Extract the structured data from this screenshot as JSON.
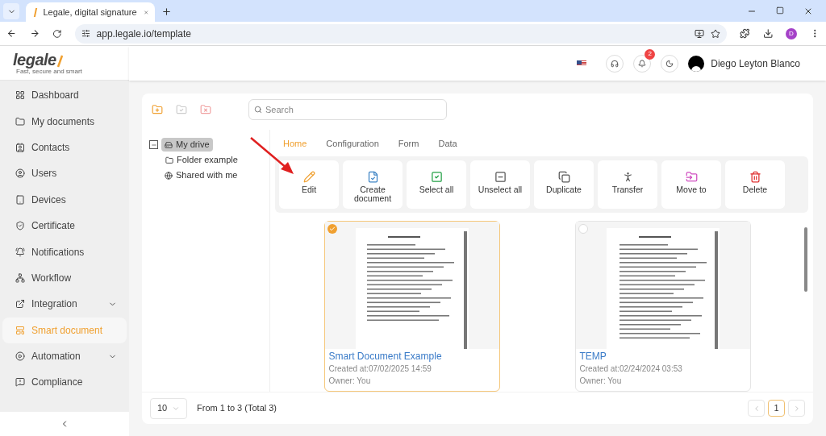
{
  "browser": {
    "tab_title": "Legale, digital signature",
    "url": "app.legale.io/template",
    "profile": "D"
  },
  "logo": {
    "text": "legale",
    "tagline": "Fast, secure and smart"
  },
  "header": {
    "notifications": "2",
    "user": "Diego Leyton Blanco"
  },
  "sidebar": {
    "items": [
      {
        "label": "Dashboard",
        "selected": false
      },
      {
        "label": "My documents",
        "selected": false
      },
      {
        "label": "Contacts",
        "selected": false
      },
      {
        "label": "Users",
        "selected": false
      },
      {
        "label": "Devices",
        "selected": false
      },
      {
        "label": "Certificate",
        "selected": false
      },
      {
        "label": "Notifications",
        "selected": false
      },
      {
        "label": "Workflow",
        "selected": false
      },
      {
        "label": "Integration",
        "selected": false,
        "expandable": true
      },
      {
        "label": "Smart document",
        "selected": true
      },
      {
        "label": "Automation",
        "selected": false,
        "expandable": true
      },
      {
        "label": "Compliance",
        "selected": false
      }
    ]
  },
  "search": {
    "placeholder": "Search"
  },
  "tree": [
    {
      "label": "My drive",
      "selected": true,
      "expanded": true,
      "children": [
        {
          "label": "Folder example",
          "selected": false
        }
      ]
    },
    {
      "label": "Shared with me",
      "selected": false
    }
  ],
  "tabs": [
    {
      "label": "Home",
      "selected": true
    },
    {
      "label": "Configuration",
      "selected": false
    },
    {
      "label": "Form",
      "selected": false
    },
    {
      "label": "Data",
      "selected": false
    }
  ],
  "actions": [
    "Edit",
    "Create document",
    "Select all",
    "Unselect all",
    "Duplicate",
    "Transfer",
    "Move to",
    "Delete"
  ],
  "documents": [
    {
      "title": "Smart Document Example",
      "created": "Created at:07/02/2025 14:59",
      "owner": "Owner: You",
      "selected": true
    },
    {
      "title": "TEMP",
      "created": "Created at:02/24/2024 03:53",
      "owner": "Owner: You",
      "selected": false
    }
  ],
  "pagination": {
    "page_size": "10",
    "summary": "From 1 to 3 (Total 3)",
    "pages": [
      {
        "label": "1",
        "selected": true
      }
    ]
  }
}
